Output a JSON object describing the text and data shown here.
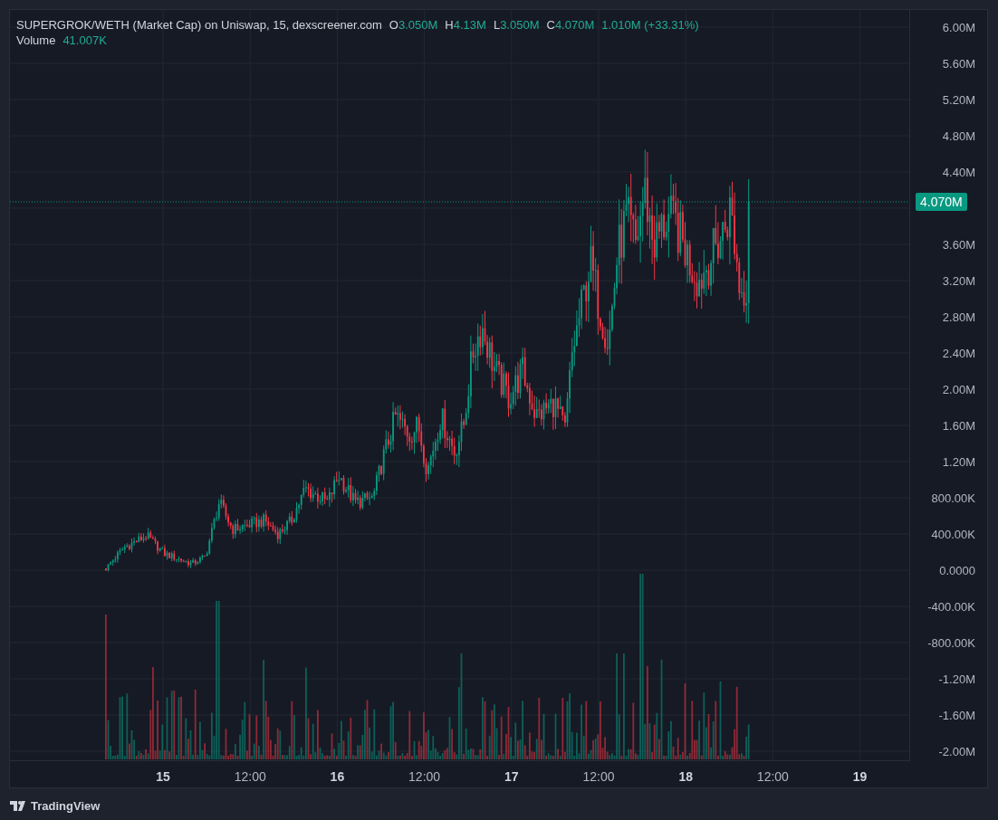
{
  "legend": {
    "symbol": "SUPERGROK/WETH (Market Cap) on Uniswap, 15, dexscreener.com",
    "ohlc": [
      {
        "label": "O",
        "value": "3.050M"
      },
      {
        "label": "H",
        "value": "4.13M"
      },
      {
        "label": "L",
        "value": "3.050M"
      },
      {
        "label": "C",
        "value": "4.070M"
      }
    ],
    "change": "1.010M (+33.31%)",
    "volume_label": "Volume",
    "volume_value": "41.007K"
  },
  "price_axis": {
    "labels_above_marker": [
      "6.00M",
      "5.60M",
      "5.20M",
      "4.80M",
      "4.40M"
    ],
    "labels_below_marker": [
      "3.60M",
      "3.20M",
      "2.80M",
      "2.40M",
      "2.00M",
      "1.60M",
      "1.20M",
      "800.00K",
      "400.00K",
      "0.0000",
      "-400.00K",
      "-800.00K",
      "-1.20M",
      "-1.60M",
      "-2.00M"
    ],
    "last_price": "4.070M"
  },
  "time_axis": {
    "labels": [
      {
        "text": "15",
        "kind": "day"
      },
      {
        "text": "12:00",
        "kind": "time"
      },
      {
        "text": "16",
        "kind": "day"
      },
      {
        "text": "12:00",
        "kind": "time"
      },
      {
        "text": "17",
        "kind": "day"
      },
      {
        "text": "12:00",
        "kind": "time"
      },
      {
        "text": "18",
        "kind": "day"
      },
      {
        "text": "12:00",
        "kind": "time"
      },
      {
        "text": "19",
        "kind": "day"
      }
    ]
  },
  "footer": {
    "logo_text": "TradingView"
  }
}
